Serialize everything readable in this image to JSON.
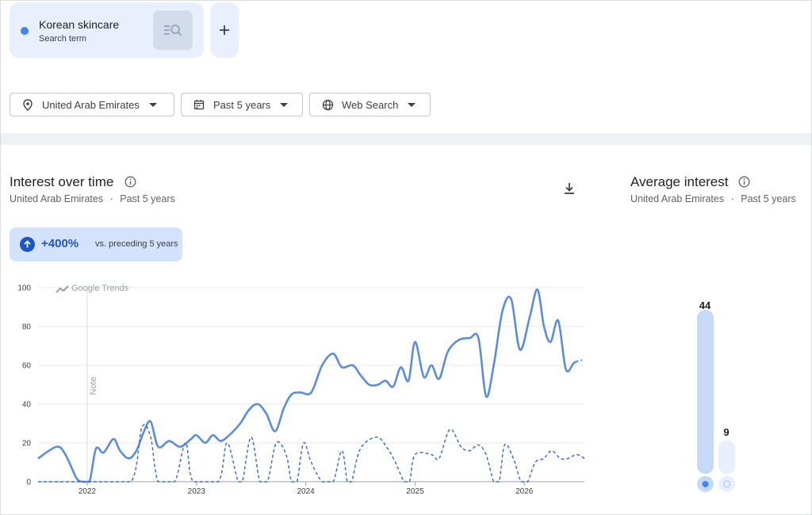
{
  "search_term": {
    "name": "Korean skincare",
    "subtitle": "Search term",
    "color": "#4285f4"
  },
  "filters": {
    "region": "United Arab Emirates",
    "period": "Past 5 years",
    "search_type": "Web Search"
  },
  "interest_over_time": {
    "title": "Interest over time",
    "subtitle_region": "United Arab Emirates",
    "subtitle_period": "Past 5 years",
    "separator": "·",
    "change_value": "+400%",
    "change_comparison": "vs. preceding 5 years",
    "watermark": "Google Trends",
    "note_label": "Note"
  },
  "average_interest": {
    "title": "Average interest",
    "subtitle_region": "United Arab Emirates",
    "subtitle_period": "Past 5 years",
    "separator": "·",
    "values": [
      44,
      9
    ]
  },
  "chart_data": {
    "type": "line",
    "xlim": [
      2021.55,
      2026.55
    ],
    "ylim": [
      0,
      100
    ],
    "yticks": [
      0,
      20,
      40,
      60,
      80,
      100
    ],
    "xticks": [
      "2022",
      "2023",
      "2024",
      "2025",
      "2026"
    ],
    "grid": true,
    "note_x": 2022.0,
    "series": [
      {
        "style": "solid",
        "color": "#5a8de0",
        "points": [
          [
            2021.55,
            12
          ],
          [
            2021.72,
            18
          ],
          [
            2021.8,
            14
          ],
          [
            2021.9,
            2
          ],
          [
            2021.95,
            0
          ],
          [
            2022.02,
            0
          ],
          [
            2022.08,
            17
          ],
          [
            2022.15,
            15
          ],
          [
            2022.24,
            22
          ],
          [
            2022.3,
            16
          ],
          [
            2022.38,
            12
          ],
          [
            2022.45,
            16
          ],
          [
            2022.52,
            26
          ],
          [
            2022.58,
            31
          ],
          [
            2022.65,
            18
          ],
          [
            2022.75,
            21
          ],
          [
            2022.85,
            18
          ],
          [
            2022.95,
            22
          ],
          [
            2023.0,
            24
          ],
          [
            2023.08,
            20
          ],
          [
            2023.15,
            24
          ],
          [
            2023.22,
            21
          ],
          [
            2023.3,
            24
          ],
          [
            2023.4,
            30
          ],
          [
            2023.48,
            37
          ],
          [
            2023.56,
            40
          ],
          [
            2023.64,
            35
          ],
          [
            2023.72,
            26
          ],
          [
            2023.8,
            38
          ],
          [
            2023.87,
            45
          ],
          [
            2023.95,
            46
          ],
          [
            2024.05,
            46
          ],
          [
            2024.15,
            60
          ],
          [
            2024.25,
            66
          ],
          [
            2024.33,
            59
          ],
          [
            2024.43,
            60
          ],
          [
            2024.5,
            55
          ],
          [
            2024.58,
            50
          ],
          [
            2024.66,
            50
          ],
          [
            2024.73,
            52
          ],
          [
            2024.8,
            49
          ],
          [
            2024.87,
            59
          ],
          [
            2024.94,
            52
          ],
          [
            2025.0,
            72
          ],
          [
            2025.08,
            54
          ],
          [
            2025.15,
            60
          ],
          [
            2025.22,
            53
          ],
          [
            2025.3,
            67
          ],
          [
            2025.4,
            73
          ],
          [
            2025.5,
            74
          ],
          [
            2025.58,
            74
          ],
          [
            2025.65,
            44
          ],
          [
            2025.72,
            60
          ],
          [
            2025.8,
            88
          ],
          [
            2025.88,
            94
          ],
          [
            2025.96,
            68
          ],
          [
            2026.05,
            85
          ],
          [
            2026.12,
            99
          ],
          [
            2026.18,
            80
          ],
          [
            2026.24,
            72
          ],
          [
            2026.31,
            83
          ],
          [
            2026.38,
            58
          ],
          [
            2026.45,
            61
          ],
          [
            2026.48,
            62
          ]
        ],
        "partial": [
          [
            2026.48,
            62
          ],
          [
            2026.55,
            63
          ]
        ]
      },
      {
        "style": "dashed",
        "color": "#3b6fd6",
        "points": [
          [
            2021.55,
            0
          ],
          [
            2022.0,
            0
          ],
          [
            2022.08,
            0
          ],
          [
            2022.4,
            0
          ],
          [
            2022.5,
            28
          ],
          [
            2022.58,
            23
          ],
          [
            2022.65,
            0
          ],
          [
            2022.8,
            0
          ],
          [
            2022.9,
            20
          ],
          [
            2022.97,
            0
          ],
          [
            2023.2,
            0
          ],
          [
            2023.28,
            20
          ],
          [
            2023.38,
            0
          ],
          [
            2023.42,
            0
          ],
          [
            2023.5,
            23
          ],
          [
            2023.58,
            0
          ],
          [
            2023.65,
            0
          ],
          [
            2023.73,
            20
          ],
          [
            2023.82,
            14
          ],
          [
            2023.87,
            0
          ],
          [
            2023.92,
            0
          ],
          [
            2023.98,
            20
          ],
          [
            2024.05,
            10
          ],
          [
            2024.15,
            0
          ],
          [
            2024.25,
            0
          ],
          [
            2024.33,
            16
          ],
          [
            2024.38,
            0
          ],
          [
            2024.42,
            0
          ],
          [
            2024.5,
            17
          ],
          [
            2024.65,
            23
          ],
          [
            2024.75,
            17
          ],
          [
            2024.82,
            10
          ],
          [
            2024.9,
            0
          ],
          [
            2024.95,
            0
          ],
          [
            2025.0,
            14
          ],
          [
            2025.15,
            14
          ],
          [
            2025.22,
            12
          ],
          [
            2025.32,
            27
          ],
          [
            2025.42,
            18
          ],
          [
            2025.5,
            16
          ],
          [
            2025.58,
            19
          ],
          [
            2025.65,
            14
          ],
          [
            2025.72,
            0
          ],
          [
            2025.77,
            0
          ],
          [
            2025.82,
            19
          ],
          [
            2025.9,
            12
          ],
          [
            2025.97,
            0
          ],
          [
            2026.03,
            0
          ],
          [
            2026.1,
            10
          ],
          [
            2026.18,
            12
          ],
          [
            2026.25,
            16
          ],
          [
            2026.33,
            12
          ],
          [
            2026.4,
            12
          ],
          [
            2026.48,
            14
          ],
          [
            2026.55,
            12
          ]
        ]
      }
    ]
  }
}
